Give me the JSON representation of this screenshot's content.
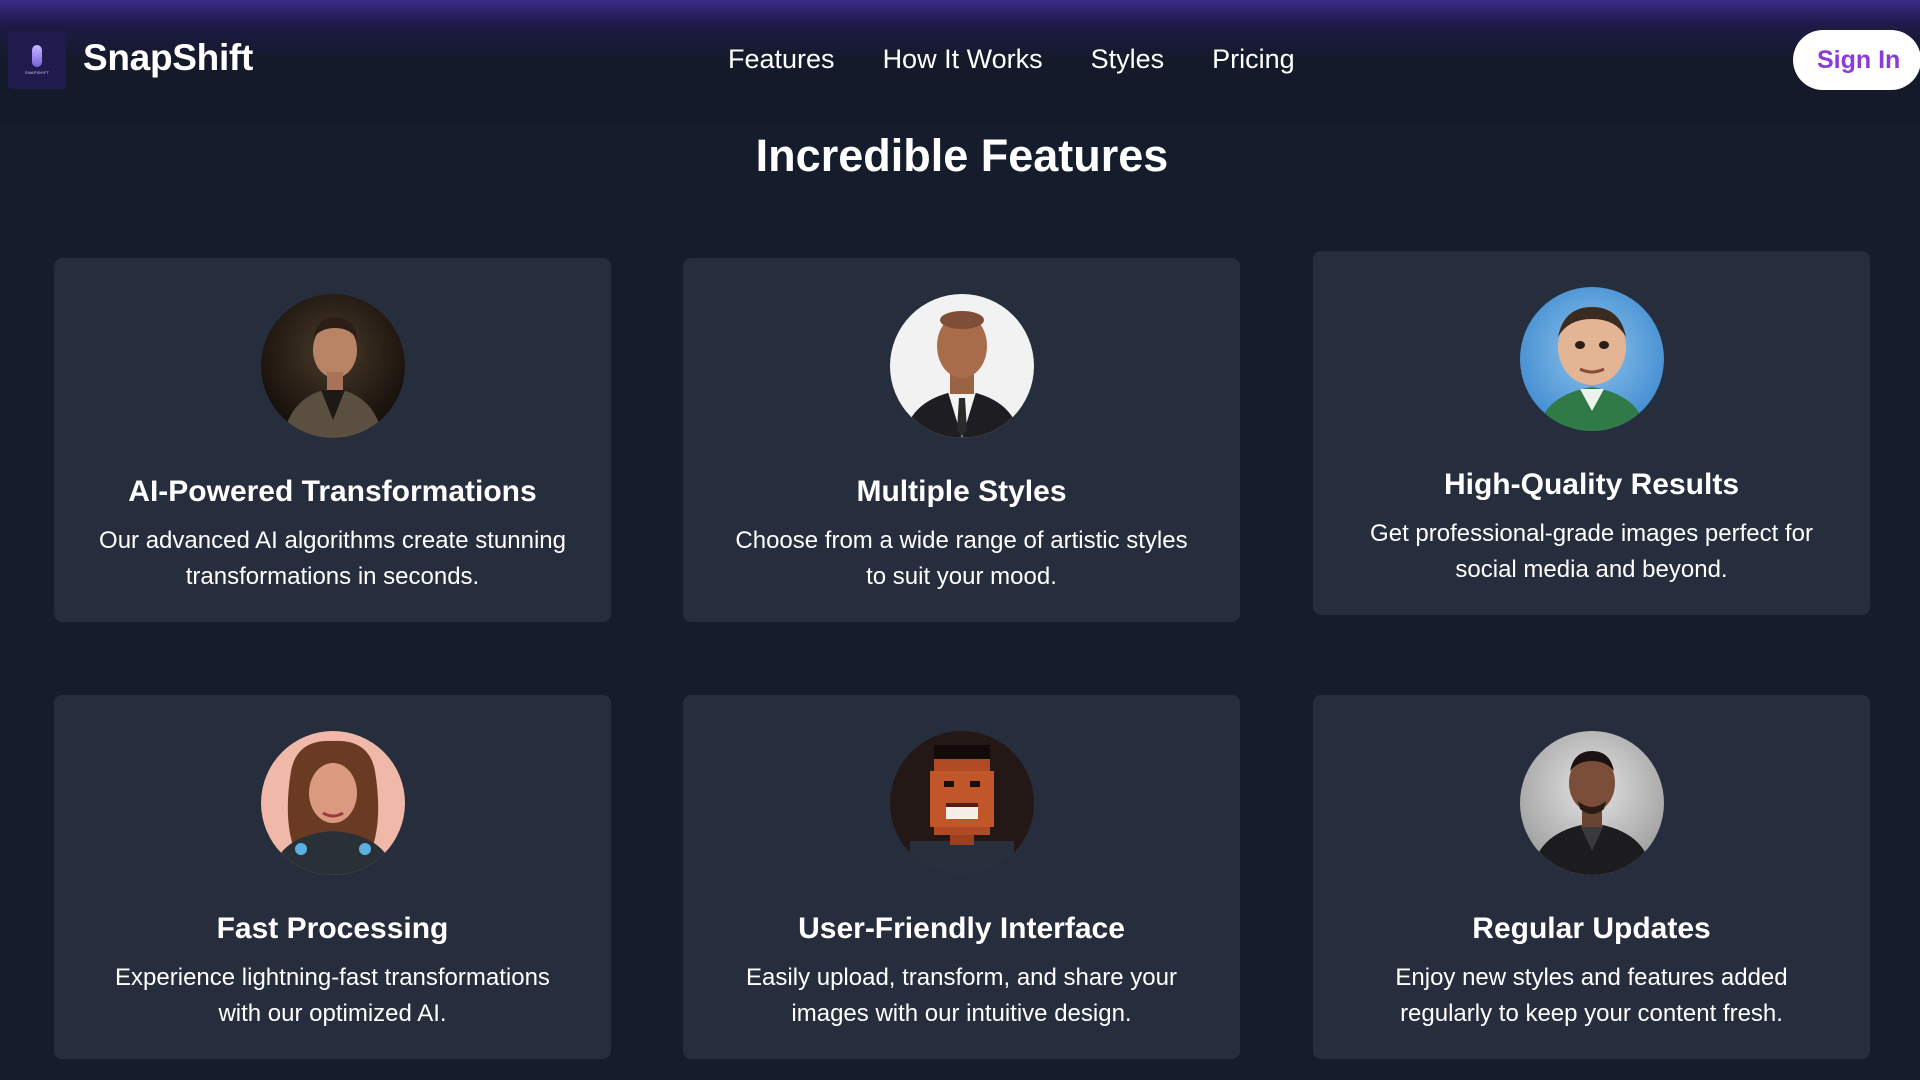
{
  "nav": {
    "brand": "SnapShift",
    "logo_text": "SNAPSHIFT",
    "links": [
      "Features",
      "How It Works",
      "Styles",
      "Pricing"
    ],
    "signin_label": "Sign In"
  },
  "main": {
    "title": "Incredible Features",
    "features": [
      {
        "title": "AI-Powered Transformations",
        "description": "Our advanced AI algorithms create stunning transformations in seconds.",
        "avatar_icon": "portrait-jacket-man-icon"
      },
      {
        "title": "Multiple Styles",
        "description": "Choose from a wide range of artistic styles to suit your mood.",
        "avatar_icon": "portrait-suit-man-icon"
      },
      {
        "title": "High-Quality Results",
        "description": "Get professional-grade images perfect for social media and beyond.",
        "avatar_icon": "portrait-caricature-man-icon"
      },
      {
        "title": "Fast Processing",
        "description": "Experience lightning-fast transformations with our optimized AI.",
        "avatar_icon": "portrait-armored-woman-icon"
      },
      {
        "title": "User-Friendly Interface",
        "description": "Easily upload, transform, and share your images with our intuitive design.",
        "avatar_icon": "portrait-pixel-man-icon"
      },
      {
        "title": "Regular Updates",
        "description": "Enjoy new styles and features added regularly to keep your content fresh.",
        "avatar_icon": "portrait-leather-jacket-man-icon"
      }
    ]
  },
  "colors": {
    "background": "#151c2b",
    "card": "#262d3c",
    "accent": "#8a3bd8",
    "topbar_gradient": "#3b2a87"
  }
}
